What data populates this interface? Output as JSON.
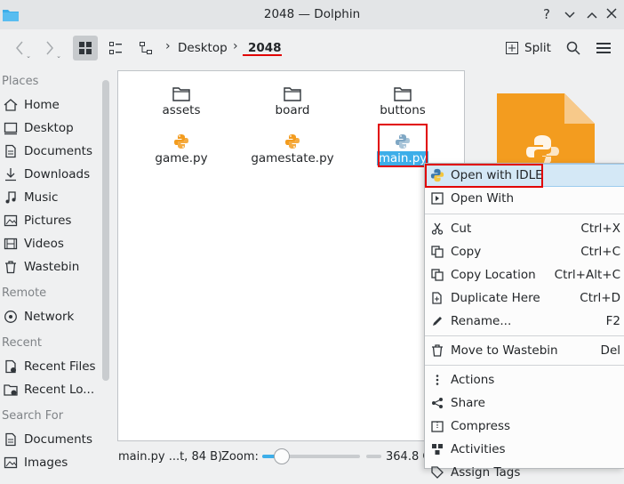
{
  "window": {
    "title": "2048 — Dolphin"
  },
  "titlebar": {
    "help": "?",
    "minimize": "⌄",
    "maximize": "⌃",
    "close": "✕"
  },
  "breadcrumb": {
    "parent": "Desktop",
    "current": "2048"
  },
  "toolbar": {
    "split_label": "Split"
  },
  "sidebar": {
    "places_head": "Places",
    "places": [
      "Home",
      "Desktop",
      "Documents",
      "Downloads",
      "Music",
      "Pictures",
      "Videos",
      "Wastebin"
    ],
    "remote_head": "Remote",
    "remote": [
      "Network"
    ],
    "recent_head": "Recent",
    "recent": [
      "Recent Files",
      "Recent Lo..."
    ],
    "search_head": "Search For",
    "search": [
      "Documents",
      "Images"
    ]
  },
  "files": {
    "folders": [
      "assets",
      "board",
      "buttons"
    ],
    "scripts": [
      "game.py",
      "gamestate.py",
      "main.py"
    ]
  },
  "status": {
    "text": "main.py ...t, 84 B)",
    "zoom_label": "Zoom:",
    "zoom_level": 0.2,
    "space": "364.8 G"
  },
  "context_menu": {
    "open_idle": "Open with IDLE",
    "open_with": "Open With",
    "cut": "Cut",
    "cut_sc": "Ctrl+X",
    "copy": "Copy",
    "copy_sc": "Ctrl+C",
    "copy_location": "Copy Location",
    "copy_location_sc": "Ctrl+Alt+C",
    "duplicate": "Duplicate Here",
    "duplicate_sc": "Ctrl+D",
    "rename": "Rename...",
    "rename_sc": "F2",
    "wastebin": "Move to Wastebin",
    "wastebin_sc": "Del",
    "actions": "Actions",
    "share": "Share",
    "compress": "Compress",
    "activities": "Activities",
    "assign_tags": "Assign Tags"
  },
  "colors": {
    "accent": "#3daee9",
    "annotation": "#e10000",
    "python_orange": "#f39c1f",
    "python_blue": "#3c78aa"
  }
}
